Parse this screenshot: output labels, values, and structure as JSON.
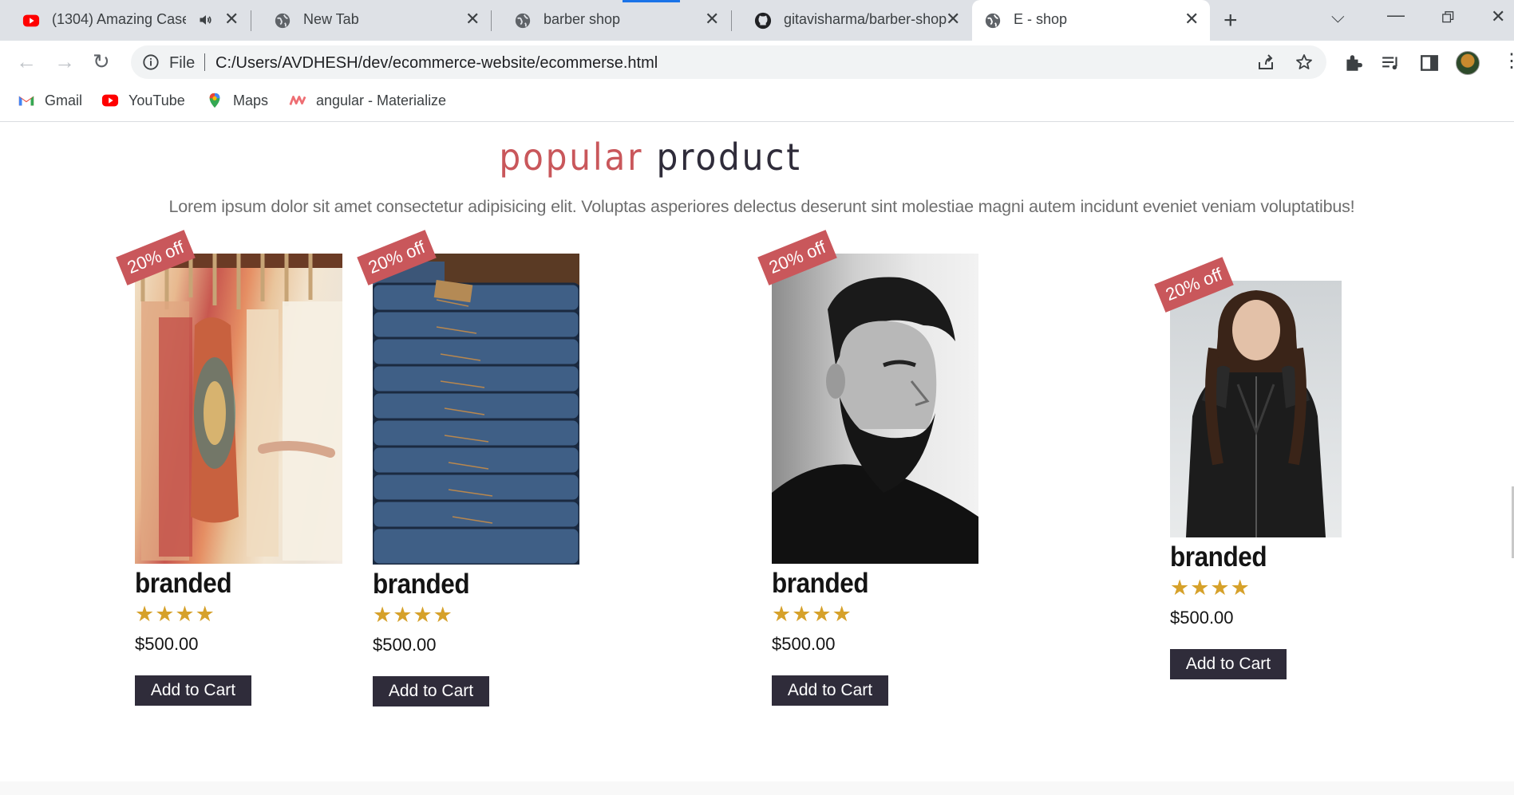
{
  "browser": {
    "tabs": [
      {
        "title": "(1304) Amazing Case",
        "icon": "youtube-icon",
        "audio": true
      },
      {
        "title": "New Tab",
        "icon": "globe-icon"
      },
      {
        "title": "barber shop",
        "icon": "globe-icon"
      },
      {
        "title": "gitavisharma/barber-shop",
        "icon": "github-icon"
      },
      {
        "title": "E - shop",
        "icon": "globe-icon",
        "active": true
      }
    ],
    "address": {
      "scheme_label": "File",
      "url": "C:/Users/AVDHESH/dev/ecommerce-website/ecommerse.html"
    },
    "bookmarks": [
      {
        "label": "Gmail",
        "icon": "gmail-icon"
      },
      {
        "label": "YouTube",
        "icon": "youtube-icon"
      },
      {
        "label": "Maps",
        "icon": "maps-icon"
      },
      {
        "label": "angular - Materialize",
        "icon": "materialize-icon"
      }
    ]
  },
  "page": {
    "heading": {
      "accent": "popular",
      "rest": "product"
    },
    "intro": "Lorem ipsum dolor sit amet consectetur adipisicing elit. Voluptas asperiores delectus deserunt sint molestiae magni autem incidunt eveniet veniam voluptatibus!",
    "products": [
      {
        "badge": "20% off",
        "title": "branded",
        "stars": "★★★★",
        "rating": 4,
        "price": "$500.00",
        "button": "Add to Cart",
        "image": "clothing-rack-photo"
      },
      {
        "badge": "20% off",
        "title": "branded",
        "stars": "★★★★",
        "rating": 4,
        "price": "$500.00",
        "button": "Add to Cart",
        "image": "folded-jeans-photo"
      },
      {
        "badge": "20% off",
        "title": "branded",
        "stars": "★★★★",
        "rating": 4,
        "price": "$500.00",
        "button": "Add to Cart",
        "image": "bearded-man-photo"
      },
      {
        "badge": "20% off",
        "title": "branded",
        "stars": "★★★★",
        "rating": 4,
        "price": "$500.00",
        "button": "Add to Cart",
        "image": "woman-leather-jacket-photo"
      }
    ]
  },
  "colors": {
    "accent": "#c9575b",
    "dark": "#2f2c3a",
    "star": "#d6a12a"
  }
}
